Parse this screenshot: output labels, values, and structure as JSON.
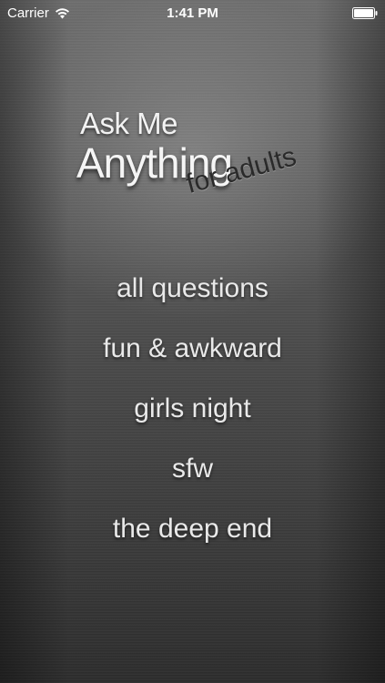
{
  "status_bar": {
    "carrier": "Carrier",
    "time": "1:41 PM",
    "icons": [
      "wifi-icon",
      "battery-icon"
    ]
  },
  "logo": {
    "line1": "Ask Me",
    "line2": "Anything",
    "subtitle": "for adults"
  },
  "menu": {
    "items": [
      {
        "label": "all questions"
      },
      {
        "label": "fun & awkward"
      },
      {
        "label": "girls night"
      },
      {
        "label": "sfw"
      },
      {
        "label": "the deep end"
      }
    ]
  },
  "colors": {
    "text": "#e9e9e9",
    "subtitle": "#2a2a2a",
    "background": "#4a4a4a"
  }
}
